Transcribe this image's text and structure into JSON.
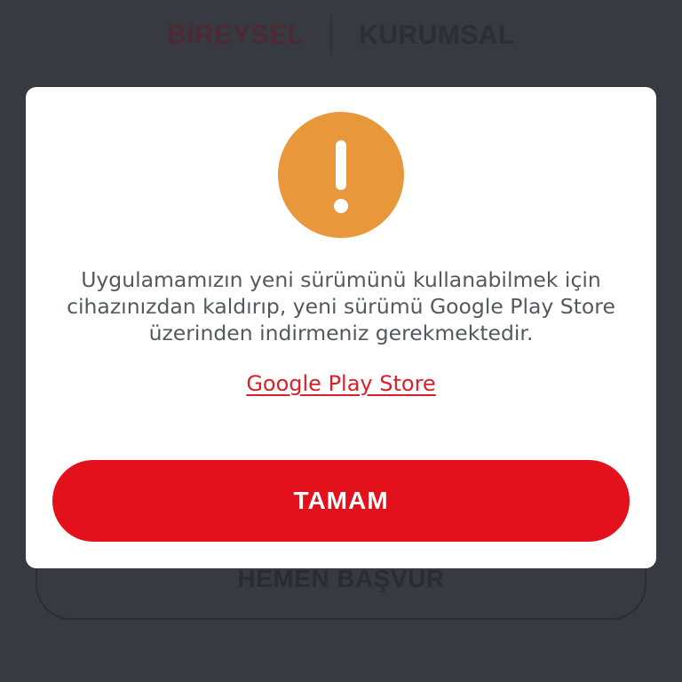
{
  "background": {
    "tabs": [
      {
        "label": "BİREYSEL",
        "active": true
      },
      {
        "label": "KURUMSAL",
        "active": false
      }
    ],
    "apply_button_label": "HEMEN BAŞVUR"
  },
  "dialog": {
    "icon": "exclamation-alert-icon",
    "icon_color": "#e8983a",
    "message": "Uygulamamızın yeni sürümünü kullanabilmek için cihazınızdan kaldırıp, yeni sürümü Google Play Store üzerinden indirmeniz gerekmektedir.",
    "link_label": "Google Play Store",
    "link_color": "#d9202b",
    "ok_button_label": "TAMAM",
    "ok_button_color": "#e2111c"
  }
}
